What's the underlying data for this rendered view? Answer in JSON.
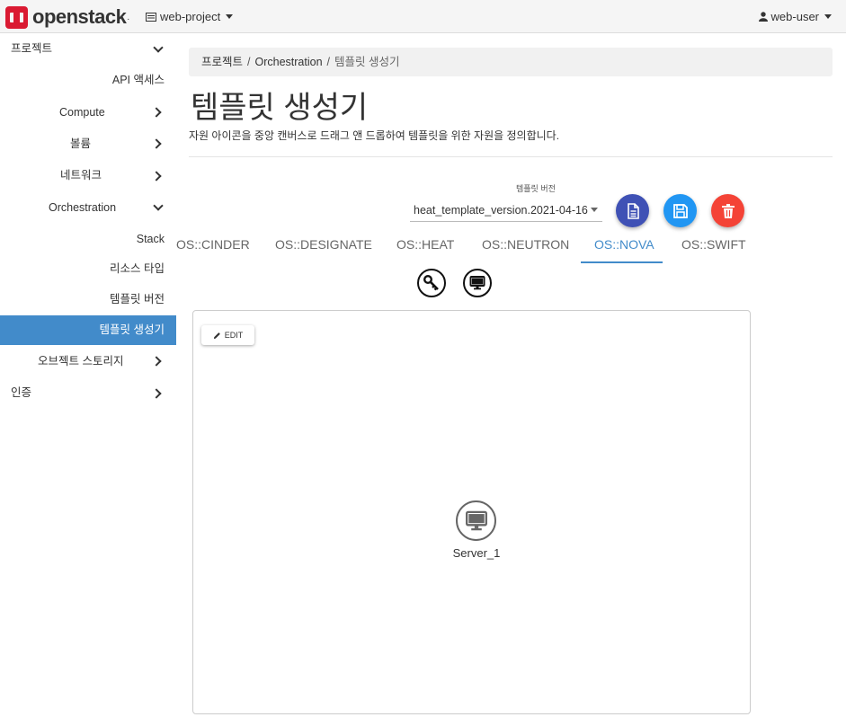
{
  "header": {
    "brand": "openstack",
    "brand_suffix": ".",
    "project": "web-project",
    "user": "web-user"
  },
  "sidebar": {
    "items": [
      {
        "label": "프로젝트",
        "chevron": "down"
      },
      {
        "label": "API 액세스"
      },
      {
        "label": "Compute",
        "chevron": "right"
      },
      {
        "label": "볼륨",
        "chevron": "right"
      },
      {
        "label": "네트워크",
        "chevron": "right"
      },
      {
        "label": "Orchestration",
        "chevron": "down"
      },
      {
        "label": "Stack"
      },
      {
        "label": "리소스 타입"
      },
      {
        "label": "템플릿 버전"
      },
      {
        "label": "템플릿 생성기",
        "active": true
      },
      {
        "label": "오브젝트 스토리지",
        "chevron": "right"
      },
      {
        "label": "인증",
        "chevron": "right"
      }
    ]
  },
  "breadcrumb": {
    "items": [
      "프로젝트",
      "Orchestration",
      "템플릿 생성기"
    ]
  },
  "page": {
    "title": "템플릿 생성기",
    "description": "자원 아이콘을 중앙 캔버스로 드래그 앤 드롭하여 템플릿을 위한 자원을 정의합니다."
  },
  "template_version": {
    "label": "템플릿 버전",
    "value": "heat_template_version.2021-04-16"
  },
  "actions": {
    "colors": {
      "document": "#3f51b5",
      "save": "#2196f3",
      "delete": "#f44336"
    }
  },
  "tabs": [
    {
      "label": "OS::CINDER"
    },
    {
      "label": "OS::DESIGNATE"
    },
    {
      "label": "OS::HEAT"
    },
    {
      "label": "OS::NEUTRON"
    },
    {
      "label": "OS::NOVA",
      "active": true
    },
    {
      "label": "OS::SWIFT"
    }
  ],
  "resource_icons": [
    "key-icon",
    "monitor-icon"
  ],
  "canvas": {
    "edit_label": "EDIT",
    "nodes": [
      {
        "label": "Server_1",
        "icon": "monitor-icon"
      }
    ]
  }
}
